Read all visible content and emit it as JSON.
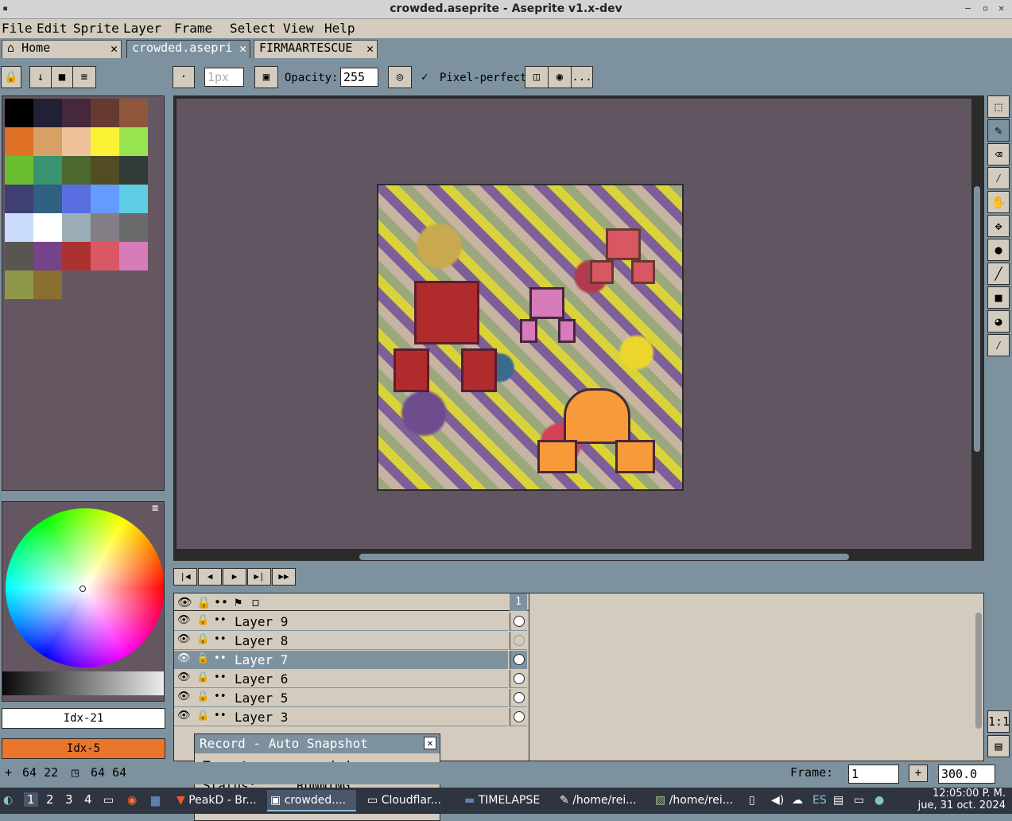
{
  "window": {
    "title": "crowded.aseprite - Aseprite v1.x-dev"
  },
  "menu": [
    "File",
    "Edit",
    "Sprite",
    "Layer",
    "Frame",
    "Select",
    "View",
    "Help"
  ],
  "tabs": [
    {
      "label": "Home",
      "icon": "home-icon"
    },
    {
      "label": "crowded.asepri"
    },
    {
      "label": "FIRMAARTESCUE"
    }
  ],
  "toolbar": {
    "brush_size_placeholder": "1px",
    "opacity_label": "Opacity:",
    "opacity_value": "255",
    "pixel_perfect_label": "Pixel-perfect",
    "more_label": "..."
  },
  "palette": {
    "colors": [
      "#000000",
      "#222034",
      "#45283c",
      "#663931",
      "#8f563b",
      "#df7126",
      "#d9a066",
      "#eec39a",
      "#fbf236",
      "#99e550",
      "#6abe30",
      "#37946e",
      "#4b692f",
      "#524b24",
      "#323c39",
      "#3f3f74",
      "#306082",
      "#5b6ee1",
      "#639bff",
      "#5fcde4",
      "#cbdbfc",
      "#ffffff",
      "#9badb7",
      "#847e87",
      "#696a6a",
      "#595652",
      "#76428a",
      "#ac3232",
      "#d95763",
      "#d77bba",
      "#8f974a",
      "#8a6f30"
    ]
  },
  "color_indices": {
    "fg": "Idx-21",
    "bg": "Idx-5"
  },
  "timeline": {
    "frame_header": "1",
    "layers": [
      {
        "name": "Layer 9",
        "selected": false,
        "has_cel": true
      },
      {
        "name": "Layer 8",
        "selected": false,
        "has_cel": false
      },
      {
        "name": "Layer 7",
        "selected": true,
        "has_cel": true
      },
      {
        "name": "Layer 6",
        "selected": false,
        "has_cel": true
      },
      {
        "name": "Layer 5",
        "selected": false,
        "has_cel": true
      },
      {
        "name": "Layer 3",
        "selected": false,
        "has_cel": true
      }
    ]
  },
  "record_popup": {
    "title": "Record - Auto Snapshot",
    "target_label": "Target:",
    "target_value": "crowded",
    "status_label": "Status:",
    "status_value": "RUNNING"
  },
  "statusbar": {
    "cursor_pos": "64 22",
    "sprite_size": "64 64",
    "frame_label": "Frame:",
    "frame_value": "1",
    "zoom_value": "300.0"
  },
  "taskbar": {
    "workspaces": [
      "1",
      "2",
      "3",
      "4"
    ],
    "windows": [
      {
        "label": "PeakD - Br...",
        "icon": "brave-icon"
      },
      {
        "label": "crowded....",
        "icon": "aseprite-icon",
        "current": true
      },
      {
        "label": "Cloudflar...",
        "icon": "window-icon"
      },
      {
        "label": "TIMELAPSE",
        "icon": "folder-icon"
      },
      {
        "label": "/home/rei...",
        "icon": "editor-icon"
      },
      {
        "label": "/home/rei...",
        "icon": "image-viewer-icon"
      }
    ],
    "keyboard_layout": "ES",
    "time": "12:05:00 P. M.",
    "date": "jue, 31 oct. 2024"
  }
}
